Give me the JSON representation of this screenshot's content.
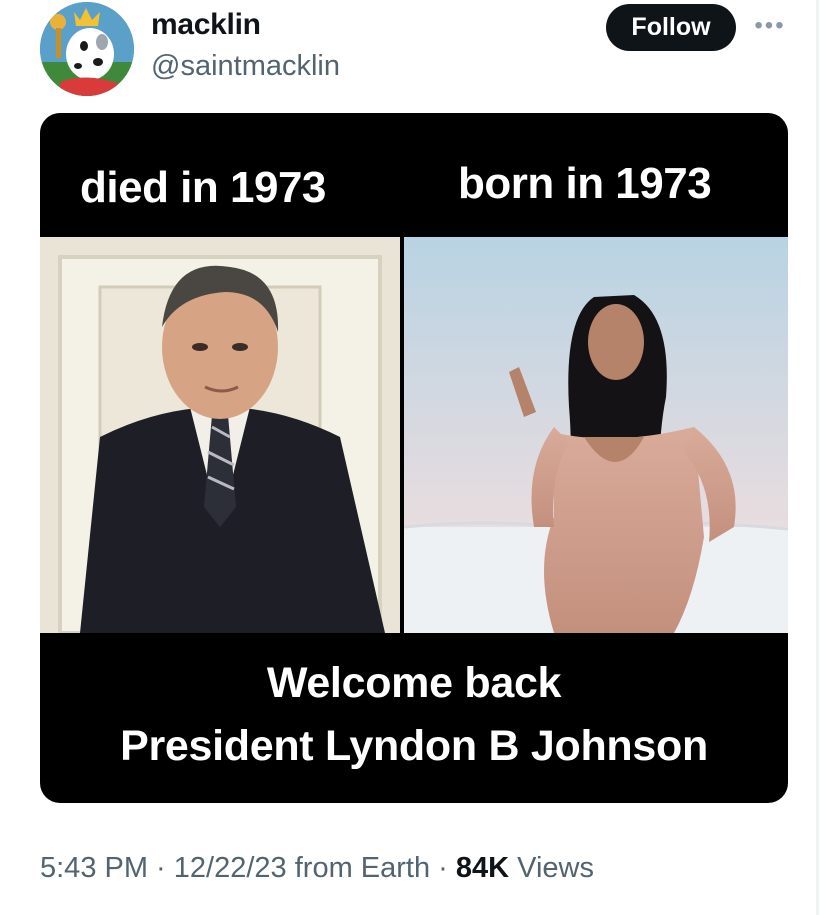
{
  "author": {
    "display_name": "macklin",
    "handle": "@saintmacklin"
  },
  "actions": {
    "follow_label": "Follow",
    "more_icon": "more-horizontal-icon"
  },
  "media": {
    "caption_left": "died in 1973",
    "caption_right": "born in 1973",
    "caption_bottom_line1": "Welcome back",
    "caption_bottom_line2": "President Lyndon B Johnson"
  },
  "meta": {
    "time": "5:43 PM",
    "separator": " · ",
    "date": "12/22/23",
    "source": "from Earth",
    "views_count": "84K",
    "views_label": "Views"
  },
  "colors": {
    "text_primary": "#0f1419",
    "text_secondary": "#536471",
    "button_bg": "#0f1419",
    "button_text": "#ffffff",
    "media_bg": "#000000"
  }
}
